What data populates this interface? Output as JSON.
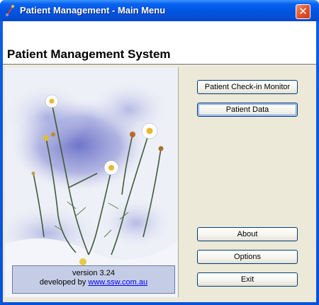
{
  "window": {
    "title": "Patient Management - Main Menu",
    "close_glyph": "✕"
  },
  "header": {
    "app_title": "Patient Management System"
  },
  "menu": {
    "check_in_label": "Patient Check-in Monitor",
    "patient_data_label": "Patient Data",
    "about_label": "About",
    "options_label": "Options",
    "exit_label": "Exit"
  },
  "footer": {
    "version": "version 3.24",
    "developed_by": "developed by",
    "link_text": "www.ssw.com.au"
  },
  "icons": {
    "app_icon": "stethoscope-icon",
    "close_icon": "close-icon"
  },
  "colors": {
    "titlebar": "#0054e3",
    "client_bg": "#ece9d8",
    "close_button": "#e5582f",
    "link": "#0000ee"
  }
}
